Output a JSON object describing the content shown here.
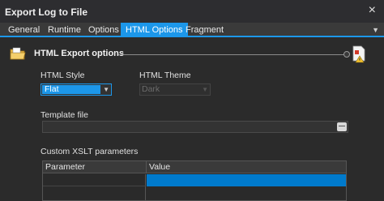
{
  "window": {
    "title": "Export Log to File",
    "close_glyph": "×"
  },
  "tabs": [
    {
      "label": "General",
      "active": false
    },
    {
      "label": "Runtime",
      "active": false
    },
    {
      "label": "Options",
      "active": false
    },
    {
      "label": "HTML Options",
      "active": true
    },
    {
      "label": "Fragment",
      "active": false
    }
  ],
  "tab_overflow_glyph": "▼",
  "section": {
    "title": "HTML Export options",
    "icon": "folder-icon",
    "right_icon": "document-warning-icon"
  },
  "html_style": {
    "label": "HTML Style",
    "value": "Flat",
    "arrow": "▼"
  },
  "html_theme": {
    "label": "HTML Theme",
    "value": "Dark",
    "arrow": "▼",
    "enabled": false
  },
  "template_file": {
    "label": "Template file",
    "value": ""
  },
  "xslt": {
    "label": "Custom XSLT parameters",
    "columns": [
      "Parameter",
      "Value"
    ]
  },
  "colors": {
    "accent": "#1c97ea",
    "selection": "#007acc",
    "background": "#2b2b2b"
  }
}
